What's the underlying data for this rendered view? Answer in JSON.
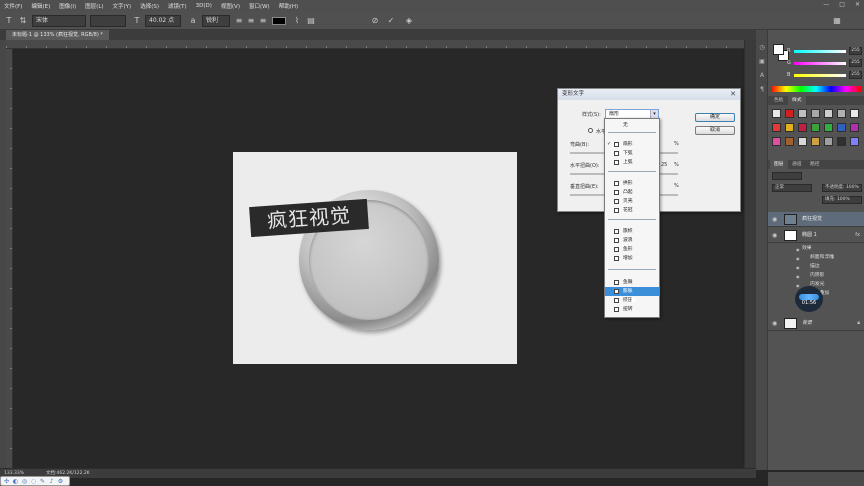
{
  "menubar": {
    "items": [
      "文件(F)",
      "编辑(E)",
      "图像(I)",
      "图层(L)",
      "文字(Y)",
      "选择(S)",
      "滤镜(T)",
      "3D(D)",
      "视图(V)",
      "窗口(W)",
      "帮助(H)"
    ],
    "window_controls": [
      "—",
      "□",
      "✕"
    ]
  },
  "options": {
    "font_family": "宋体",
    "font_size": "40.02 点",
    "anti_alias": "锐利",
    "icons": [
      "type-tool-icon",
      "orientation-icon",
      "font-size-icon",
      "align-left-icon",
      "align-center-icon",
      "align-right-icon",
      "text-color-swatch",
      "warp-icon",
      "panel-icon",
      "cancel-icon",
      "commit-icon",
      "3d-icon"
    ]
  },
  "document": {
    "tab_title": "未标题-1 @ 133% (疯狂视觉, RGB/8) *",
    "zoom": "133.33%",
    "doc_info": "文档:462.2K/122.2K"
  },
  "canvas": {
    "badge_text": "疯狂视觉",
    "background": "#ececec"
  },
  "warp_dialog": {
    "title": "变形文字",
    "style_label": "样式(S):",
    "style_value": "扇形",
    "orientation_label": "水平",
    "bend_label": "弯曲(B):",
    "hdist_label": "水平扭曲(O):",
    "vdist_label": "垂直扭曲(E):",
    "pct": "%",
    "hdist_partial": "25",
    "ok_label": "确定",
    "cancel_label": "取消"
  },
  "style_dropdown": {
    "items": [
      "无",
      "扇形",
      "下弧",
      "上弧",
      "拱形",
      "凸起",
      "贝壳",
      "花冠",
      "旗帜",
      "波浪",
      "鱼形",
      "增加",
      "鱼眼",
      "膨胀",
      "挤压",
      "扭转"
    ],
    "checked": "扇形",
    "selected": "膨胀"
  },
  "color_panel": {
    "channels": [
      {
        "name": "R",
        "value": "255"
      },
      {
        "name": "G",
        "value": "255"
      },
      {
        "name": "B",
        "value": "255"
      }
    ]
  },
  "swatch_tabs": [
    "色板",
    "样式"
  ],
  "layers_panel": {
    "tabs": [
      "图层",
      "通道",
      "路径"
    ],
    "blend_mode": "正常",
    "opacity": "不透明度: 100%",
    "fill": "填充: 100%",
    "layers": [
      {
        "name": "疯狂视觉",
        "active": true,
        "fx": ""
      },
      {
        "name": "椭圆 1",
        "active": false,
        "fx": "fx"
      },
      {
        "name": "背景",
        "active": false,
        "fx": ""
      }
    ],
    "effects_label": "效果",
    "effects": [
      "斜面和浮雕",
      "描边",
      "内阴影",
      "内发光",
      "渐变叠加",
      "投影"
    ]
  },
  "timer": "01:56",
  "colors": {
    "accent": "#3b8ed8",
    "ui_dark": "#262626",
    "panel": "#535353"
  }
}
